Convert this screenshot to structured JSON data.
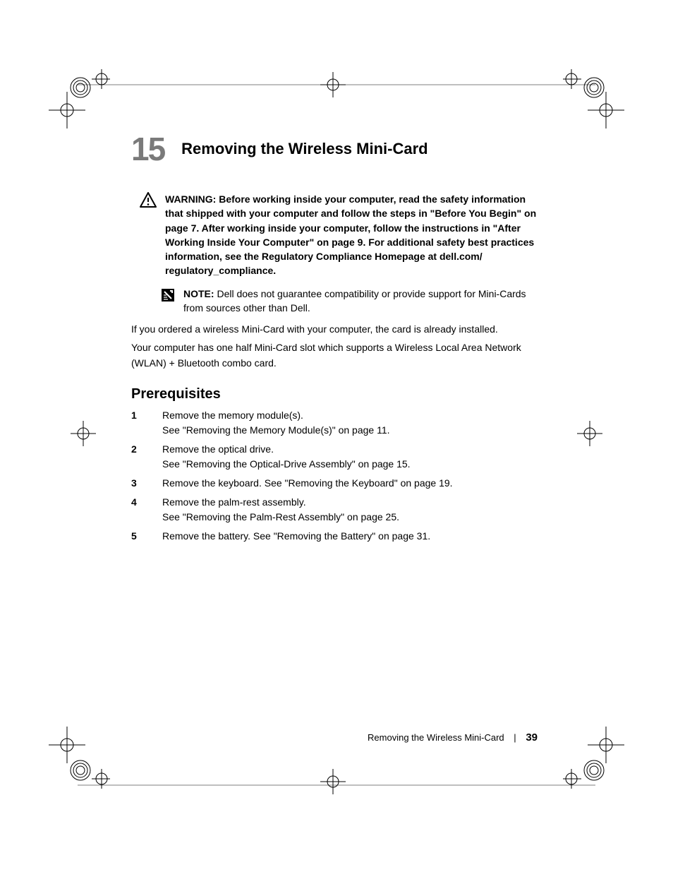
{
  "chapter": {
    "number": "15",
    "title": "Removing the Wireless Mini-Card"
  },
  "warning": {
    "label": "WARNING:  ",
    "text": "Before working inside your computer, read the safety information that shipped with your computer and follow the steps in \"Before You Begin\" on page 7. After working inside your computer, follow the instructions in \"After Working Inside Your Computer\" on page 9. For additional safety best practices information, see the Regulatory Compliance Homepage at dell.com/ regulatory_compliance."
  },
  "note": {
    "label": "NOTE: ",
    "text": "Dell does not guarantee compatibility or provide support for Mini-Cards from sources other than Dell."
  },
  "body": {
    "p1": "If you ordered a wireless Mini-Card with your computer, the card is already installed.",
    "p2": "Your computer has one half Mini-Card slot which supports a Wireless Local Area Network (WLAN) + Bluetooth combo card."
  },
  "prerequisites": {
    "heading": "Prerequisites",
    "items": [
      "Remove the memory module(s).\nSee \"Removing the Memory Module(s)\" on page 11.",
      "Remove the optical drive.\nSee \"Removing the Optical-Drive Assembly\" on page 15.",
      "Remove the keyboard. See \"Removing the Keyboard\" on page 19.",
      "Remove the palm-rest assembly.\nSee \"Removing the Palm-Rest Assembly\" on page 25.",
      "Remove the battery. See \"Removing the Battery\" on page 31."
    ]
  },
  "footer": {
    "section": "Removing the Wireless Mini-Card",
    "separator": "|",
    "page": "39"
  }
}
